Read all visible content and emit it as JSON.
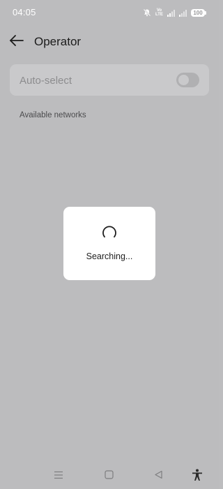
{
  "status_bar": {
    "time": "04:05",
    "volte_label": "Vo LTE",
    "battery": "100",
    "icons": [
      "bell-off-icon",
      "volte-icon",
      "signal-icon",
      "signal-icon",
      "battery-icon"
    ]
  },
  "header": {
    "title": "Operator",
    "back_icon": "arrow-left-icon"
  },
  "auto_select": {
    "label": "Auto-select",
    "enabled": false
  },
  "networks": {
    "section_label": "Available networks"
  },
  "dialog": {
    "message": "Searching...",
    "icon": "spinner-icon"
  },
  "nav_bar": {
    "icons": [
      "menu-icon",
      "home-icon",
      "back-triangle-icon",
      "accessibility-icon"
    ]
  },
  "colors": {
    "scrim_background": "#bcbcbe",
    "card": "#c9c9cb",
    "dialog": "#ffffff",
    "text_primary": "#1b1b1b"
  }
}
